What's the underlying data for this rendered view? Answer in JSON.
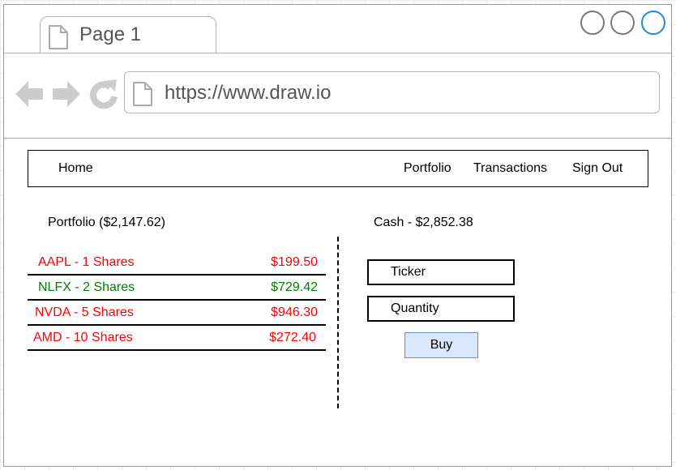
{
  "browser": {
    "tab_title": "Page 1",
    "url": "https://www.draw.io",
    "window_controls": [
      "minimize-icon",
      "maximize-icon",
      "close-icon"
    ],
    "accent_color": "#1a8cd8"
  },
  "nav": {
    "home": "Home",
    "portfolio": "Portfolio",
    "transactions": "Transactions",
    "sign_out": "Sign Out"
  },
  "portfolio": {
    "title": "Portfolio ($2,147.62)",
    "holdings": [
      {
        "name": "AAPL - 1 Shares",
        "value": "$199.50",
        "color": "#ff0000"
      },
      {
        "name": "NLFX - 2 Shares",
        "value": "$729.42",
        "color": "#008000"
      },
      {
        "name": "NVDA - 5 Shares",
        "value": "$946.30",
        "color": "#ff0000"
      },
      {
        "name": "AMD - 10 Shares",
        "value": "$272.40",
        "color": "#ff0000"
      }
    ]
  },
  "trade": {
    "cash": "Cash - $2,852.38",
    "ticker_placeholder": "Ticker",
    "quantity_placeholder": "Quantity",
    "buy_label": "Buy",
    "buy_color": "#dae8fc"
  }
}
